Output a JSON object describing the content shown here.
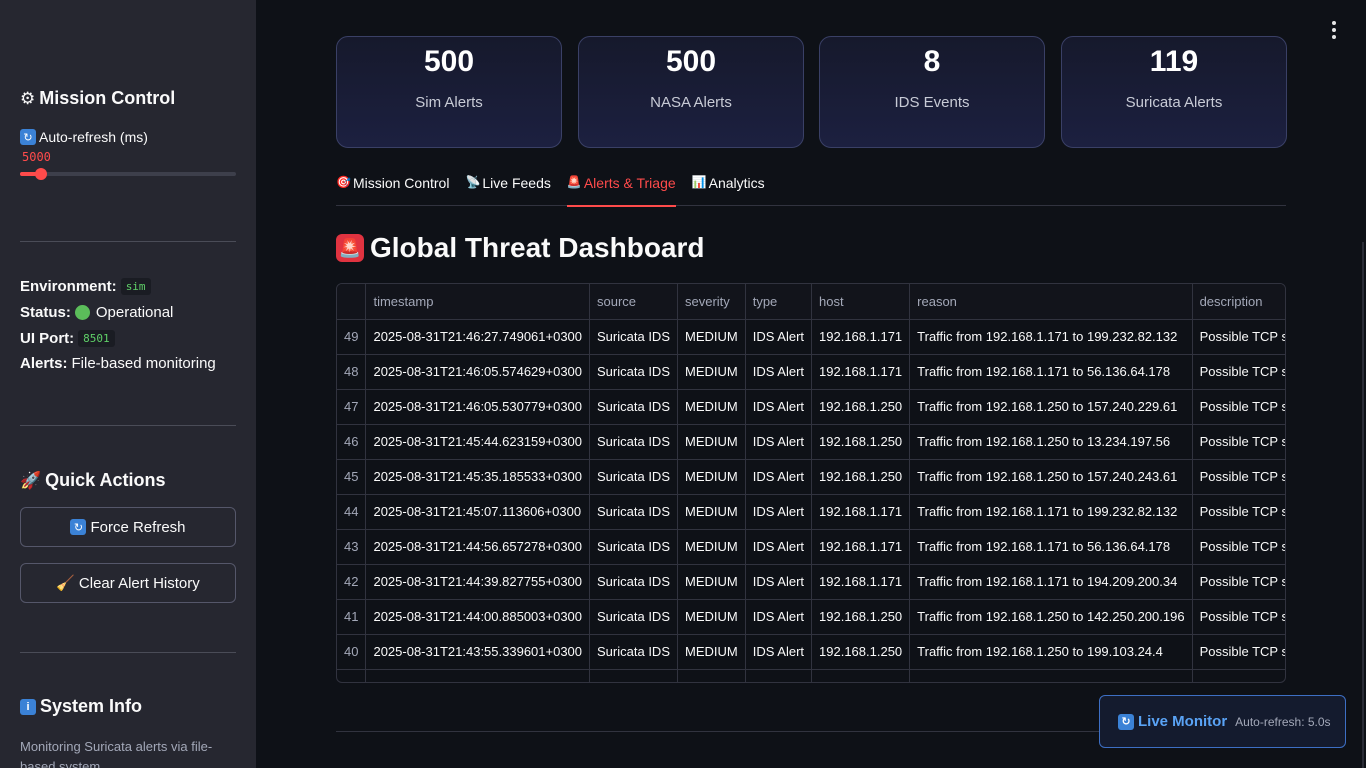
{
  "sidebar": {
    "mission_title": "Mission Control",
    "slider_label": "Auto-refresh (ms)",
    "slider_value": "5000",
    "slider_fraction": 0.08,
    "environment_label": "Environment:",
    "environment_value": "sim",
    "status_label": "Status:",
    "status_value": "Operational",
    "port_label": "UI Port:",
    "port_value": "8501",
    "alerts_label": "Alerts:",
    "alerts_value": "File-based monitoring",
    "quick_actions_title": "Quick Actions",
    "force_refresh_label": "Force Refresh",
    "clear_history_label": "Clear Alert History",
    "system_info_title": "System Info",
    "system_info_text": "Monitoring Suricata alerts via file-based system"
  },
  "metrics": [
    {
      "value": "500",
      "label": "Sim Alerts"
    },
    {
      "value": "500",
      "label": "NASA Alerts"
    },
    {
      "value": "8",
      "label": "IDS Events"
    },
    {
      "value": "119",
      "label": "Suricata Alerts"
    }
  ],
  "tabs": [
    {
      "label": "Mission Control",
      "icon": "target-icon"
    },
    {
      "label": "Live Feeds",
      "icon": "satellite-icon"
    },
    {
      "label": "Alerts & Triage",
      "icon": "siren-icon"
    },
    {
      "label": "Analytics",
      "icon": "bar-chart-icon"
    }
  ],
  "dashboard_title": "Global Threat Dashboard",
  "table": {
    "columns": [
      "",
      "timestamp",
      "source",
      "severity",
      "type",
      "host",
      "reason",
      "description"
    ],
    "rows": [
      [
        "49",
        "2025-08-31T21:46:27.749061+0300",
        "Suricata IDS",
        "MEDIUM",
        "IDS Alert",
        "192.168.1.171",
        "Traffic from 192.168.1.171 to 199.232.82.132",
        "Possible TCP s"
      ],
      [
        "48",
        "2025-08-31T21:46:05.574629+0300",
        "Suricata IDS",
        "MEDIUM",
        "IDS Alert",
        "192.168.1.171",
        "Traffic from 192.168.1.171 to 56.136.64.178",
        "Possible TCP s"
      ],
      [
        "47",
        "2025-08-31T21:46:05.530779+0300",
        "Suricata IDS",
        "MEDIUM",
        "IDS Alert",
        "192.168.1.250",
        "Traffic from 192.168.1.250 to 157.240.229.61",
        "Possible TCP s"
      ],
      [
        "46",
        "2025-08-31T21:45:44.623159+0300",
        "Suricata IDS",
        "MEDIUM",
        "IDS Alert",
        "192.168.1.250",
        "Traffic from 192.168.1.250 to 13.234.197.56",
        "Possible TCP s"
      ],
      [
        "45",
        "2025-08-31T21:45:35.185533+0300",
        "Suricata IDS",
        "MEDIUM",
        "IDS Alert",
        "192.168.1.250",
        "Traffic from 192.168.1.250 to 157.240.243.61",
        "Possible TCP s"
      ],
      [
        "44",
        "2025-08-31T21:45:07.113606+0300",
        "Suricata IDS",
        "MEDIUM",
        "IDS Alert",
        "192.168.1.171",
        "Traffic from 192.168.1.171 to 199.232.82.132",
        "Possible TCP s"
      ],
      [
        "43",
        "2025-08-31T21:44:56.657278+0300",
        "Suricata IDS",
        "MEDIUM",
        "IDS Alert",
        "192.168.1.171",
        "Traffic from 192.168.1.171 to 56.136.64.178",
        "Possible TCP s"
      ],
      [
        "42",
        "2025-08-31T21:44:39.827755+0300",
        "Suricata IDS",
        "MEDIUM",
        "IDS Alert",
        "192.168.1.171",
        "Traffic from 192.168.1.171 to 194.209.200.34",
        "Possible TCP s"
      ],
      [
        "41",
        "2025-08-31T21:44:00.885003+0300",
        "Suricata IDS",
        "MEDIUM",
        "IDS Alert",
        "192.168.1.250",
        "Traffic from 192.168.1.250 to 142.250.200.196",
        "Possible TCP s"
      ],
      [
        "40",
        "2025-08-31T21:43:55.339601+0300",
        "Suricata IDS",
        "MEDIUM",
        "IDS Alert",
        "192.168.1.250",
        "Traffic from 192.168.1.250 to 199.103.24.4",
        "Possible TCP s"
      ]
    ]
  },
  "live_monitor": {
    "title": "Live Monitor",
    "subtitle": "Auto-refresh: 5.0s"
  },
  "colors": {
    "accent": "#ff4b4b",
    "sidebar_bg": "#262730",
    "page_bg": "#0e1117",
    "info_blue": "#5aa3f5"
  }
}
